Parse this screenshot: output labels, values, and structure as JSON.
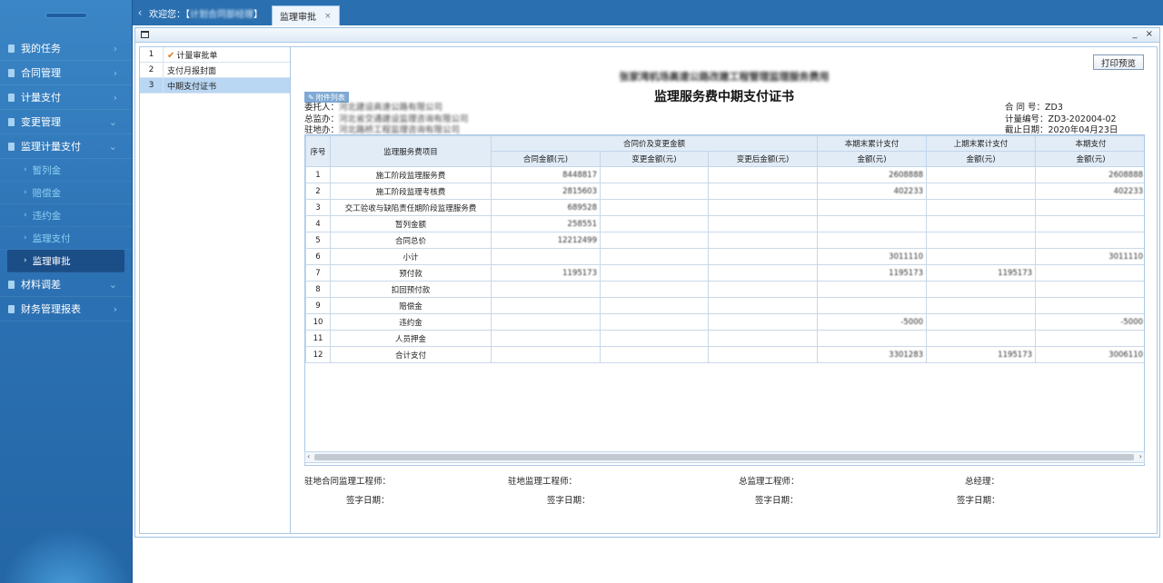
{
  "sidebar": {
    "menu": [
      {
        "label": "我的任务",
        "arrow": "›"
      },
      {
        "label": "合同管理",
        "arrow": "›"
      },
      {
        "label": "计量支付",
        "arrow": "›"
      },
      {
        "label": "变更管理",
        "arrow": "⌄"
      },
      {
        "label": "监理计量支付",
        "arrow": "⌄"
      }
    ],
    "submenu": [
      {
        "label": "暂列金"
      },
      {
        "label": "赔偿金"
      },
      {
        "label": "违约金"
      },
      {
        "label": "监理支付"
      },
      {
        "label": "监理审批"
      }
    ],
    "menu_after": [
      {
        "label": "材料调差",
        "arrow": "⌄"
      },
      {
        "label": "财务管理报表",
        "arrow": "›"
      }
    ]
  },
  "tabbar": {
    "back_icon": "‹",
    "welcome_prefix": "欢迎您：【",
    "welcome_name": "计划合同部经理",
    "welcome_suffix": "】",
    "active_tab": "监理审批",
    "close_icon": "×"
  },
  "panel": {
    "controls": "_ ×"
  },
  "docnav": [
    {
      "num": "1",
      "label": "计量审批单",
      "checked": true
    },
    {
      "num": "2",
      "label": "支付月报封面",
      "checked": false
    },
    {
      "num": "3",
      "label": "中期支付证书",
      "checked": false
    }
  ],
  "document": {
    "print_button": "打印预览",
    "project_line": "张家湾机场高速公路改建工程管理监理服务费用",
    "title": "监理服务费中期支付证书",
    "attach_tag": "附件列表",
    "client_label": "委托人：",
    "client_value": "河北建设高速公路有限公司",
    "supervisor_label": "总监办：",
    "supervisor_value": "河北省交通建设监理咨询有限公司",
    "resident_label": "驻地办：",
    "resident_value": "河北路桥工程监理咨询有限公司",
    "contract_label": "合 同 号：",
    "contract_value": "ZD3",
    "measure_label": "计量编号：",
    "measure_value": "ZD3-202004-02",
    "date_label": "截止日期：",
    "date_value": "2020年04月23日"
  },
  "table": {
    "headers": {
      "seq": "序号",
      "item": "监理服务费项目",
      "group_contract": "合同价及变更金额",
      "contract_amount": "合同金额(元)",
      "change_amount": "变更金额(元)",
      "after_change": "变更后金额(元)",
      "group_current_total": "本期末累计支付",
      "group_prev_total": "上期末累计支付",
      "group_current": "本期支付",
      "amount": "金额(元)"
    },
    "rows": [
      {
        "seq": "1",
        "item": "施工阶段监理服务费",
        "contract": "8448817",
        "cur_total": "2608888",
        "prev_total": "",
        "current": "2608888"
      },
      {
        "seq": "2",
        "item": "施工阶段监理考核费",
        "contract": "2815603",
        "cur_total": "402233",
        "prev_total": "",
        "current": "402233"
      },
      {
        "seq": "3",
        "item": "交工验收与缺陷责任期阶段监理服务费",
        "contract": "689528",
        "cur_total": "",
        "prev_total": "",
        "current": ""
      },
      {
        "seq": "4",
        "item": "暂列金额",
        "contract": "258551",
        "cur_total": "",
        "prev_total": "",
        "current": ""
      },
      {
        "seq": "5",
        "item": "合同总价",
        "contract": "12212499",
        "cur_total": "",
        "prev_total": "",
        "current": ""
      },
      {
        "seq": "6",
        "item": "小计",
        "contract": "",
        "cur_total": "3011110",
        "prev_total": "",
        "current": "3011110"
      },
      {
        "seq": "7",
        "item": "预付款",
        "contract": "1195173",
        "cur_total": "1195173",
        "prev_total": "1195173",
        "current": ""
      },
      {
        "seq": "8",
        "item": "扣回预付款",
        "contract": "",
        "cur_total": "",
        "prev_total": "",
        "current": ""
      },
      {
        "seq": "9",
        "item": "赔偿金",
        "contract": "",
        "cur_total": "",
        "prev_total": "",
        "current": ""
      },
      {
        "seq": "10",
        "item": "违约金",
        "contract": "",
        "cur_total": "-5000",
        "prev_total": "",
        "current": "-5000"
      },
      {
        "seq": "11",
        "item": "人员押金",
        "contract": "",
        "cur_total": "",
        "prev_total": "",
        "current": ""
      },
      {
        "seq": "12",
        "item": "合计支付",
        "contract": "",
        "cur_total": "3301283",
        "prev_total": "1195173",
        "current": "3006110"
      }
    ]
  },
  "scrollbar": {
    "left": "‹",
    "right": "›"
  },
  "signatures": {
    "row1": [
      "驻地合同监理工程师：",
      "驻地监理工程师：",
      "总监理工程师：",
      "总经理："
    ],
    "row2": [
      "签字日期：",
      "签字日期：",
      "签字日期：",
      "签字日期："
    ]
  }
}
